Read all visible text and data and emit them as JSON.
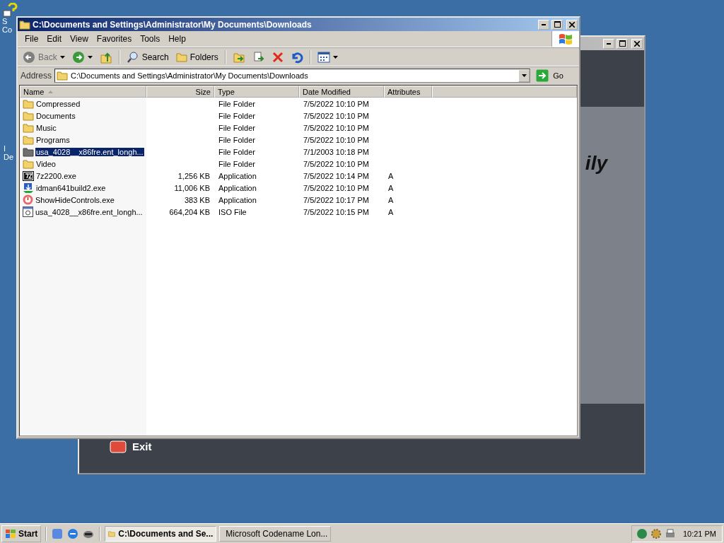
{
  "desktop_icons": [
    {
      "label_lines": [
        "S",
        "Co"
      ]
    },
    {
      "label_lines": [
        "I",
        "De"
      ]
    }
  ],
  "back_window": {
    "active": false,
    "headline_fragment": "ily",
    "exit_label": "Exit"
  },
  "window": {
    "title": "C:\\Documents and Settings\\Administrator\\My Documents\\Downloads",
    "active": true
  },
  "menu": [
    "File",
    "Edit",
    "View",
    "Favorites",
    "Tools",
    "Help"
  ],
  "toolbar": [
    {
      "kind": "back",
      "label": "Back",
      "disabled": true
    },
    {
      "kind": "forward",
      "disabled": false
    },
    {
      "kind": "up",
      "disabled": false
    },
    {
      "kind": "search",
      "label": "Search",
      "disabled": false
    },
    {
      "kind": "folders",
      "label": "Folders",
      "disabled": false
    },
    {
      "kind": "move",
      "disabled": false
    },
    {
      "kind": "copy",
      "disabled": false
    },
    {
      "kind": "delete",
      "disabled": false
    },
    {
      "kind": "undo",
      "disabled": false
    },
    {
      "kind": "views",
      "disabled": false
    }
  ],
  "address": {
    "label": "Address",
    "value": "C:\\Documents and Settings\\Administrator\\My Documents\\Downloads",
    "go": "Go"
  },
  "table": {
    "columns": [
      {
        "label": "Name",
        "sorted": true
      },
      {
        "label": "Size",
        "sorted": false
      },
      {
        "label": "Type",
        "sorted": false
      },
      {
        "label": "Date Modified",
        "sorted": false
      },
      {
        "label": "Attributes",
        "sorted": false
      }
    ],
    "rows": [
      {
        "kind": "folder",
        "name": "Compressed",
        "size": "",
        "type": "File Folder",
        "date": "7/5/2022 10:10 PM",
        "attributes": "",
        "selected": false
      },
      {
        "kind": "folder",
        "name": "Documents",
        "size": "",
        "type": "File Folder",
        "date": "7/5/2022 10:10 PM",
        "attributes": "",
        "selected": false
      },
      {
        "kind": "folder",
        "name": "Music",
        "size": "",
        "type": "File Folder",
        "date": "7/5/2022 10:10 PM",
        "attributes": "",
        "selected": false
      },
      {
        "kind": "folder",
        "name": "Programs",
        "size": "",
        "type": "File Folder",
        "date": "7/5/2022 10:10 PM",
        "attributes": "",
        "selected": false
      },
      {
        "kind": "folder",
        "name": "usa_4028__x86fre.ent_longh...",
        "size": "",
        "type": "File Folder",
        "date": "7/1/2003 10:18 PM",
        "attributes": "",
        "selected": true
      },
      {
        "kind": "folder",
        "name": "Video",
        "size": "",
        "type": "File Folder",
        "date": "7/5/2022 10:10 PM",
        "attributes": "",
        "selected": false
      },
      {
        "kind": "archiver",
        "name": "7z2200.exe",
        "size": "1,256 KB",
        "type": "Application",
        "date": "7/5/2022 10:14 PM",
        "attributes": "A",
        "selected": false
      },
      {
        "kind": "downloader",
        "name": "idman641build2.exe",
        "size": "11,006 KB",
        "type": "Application",
        "date": "7/5/2022 10:10 PM",
        "attributes": "A",
        "selected": false
      },
      {
        "kind": "power",
        "name": "ShowHideControls.exe",
        "size": "383 KB",
        "type": "Application",
        "date": "7/5/2022 10:17 PM",
        "attributes": "A",
        "selected": false
      },
      {
        "kind": "disc",
        "name": "usa_4028__x86fre.ent_longh...",
        "size": "664,204 KB",
        "type": "ISO File",
        "date": "7/5/2022 10:15 PM",
        "attributes": "A",
        "selected": false
      }
    ]
  },
  "taskbar": {
    "start": "Start",
    "tasks": [
      {
        "label": "C:\\Documents and Se...",
        "selected": true
      },
      {
        "label": "Microsoft Codename Lon...",
        "selected": false
      }
    ],
    "clock": "10:21 PM"
  }
}
